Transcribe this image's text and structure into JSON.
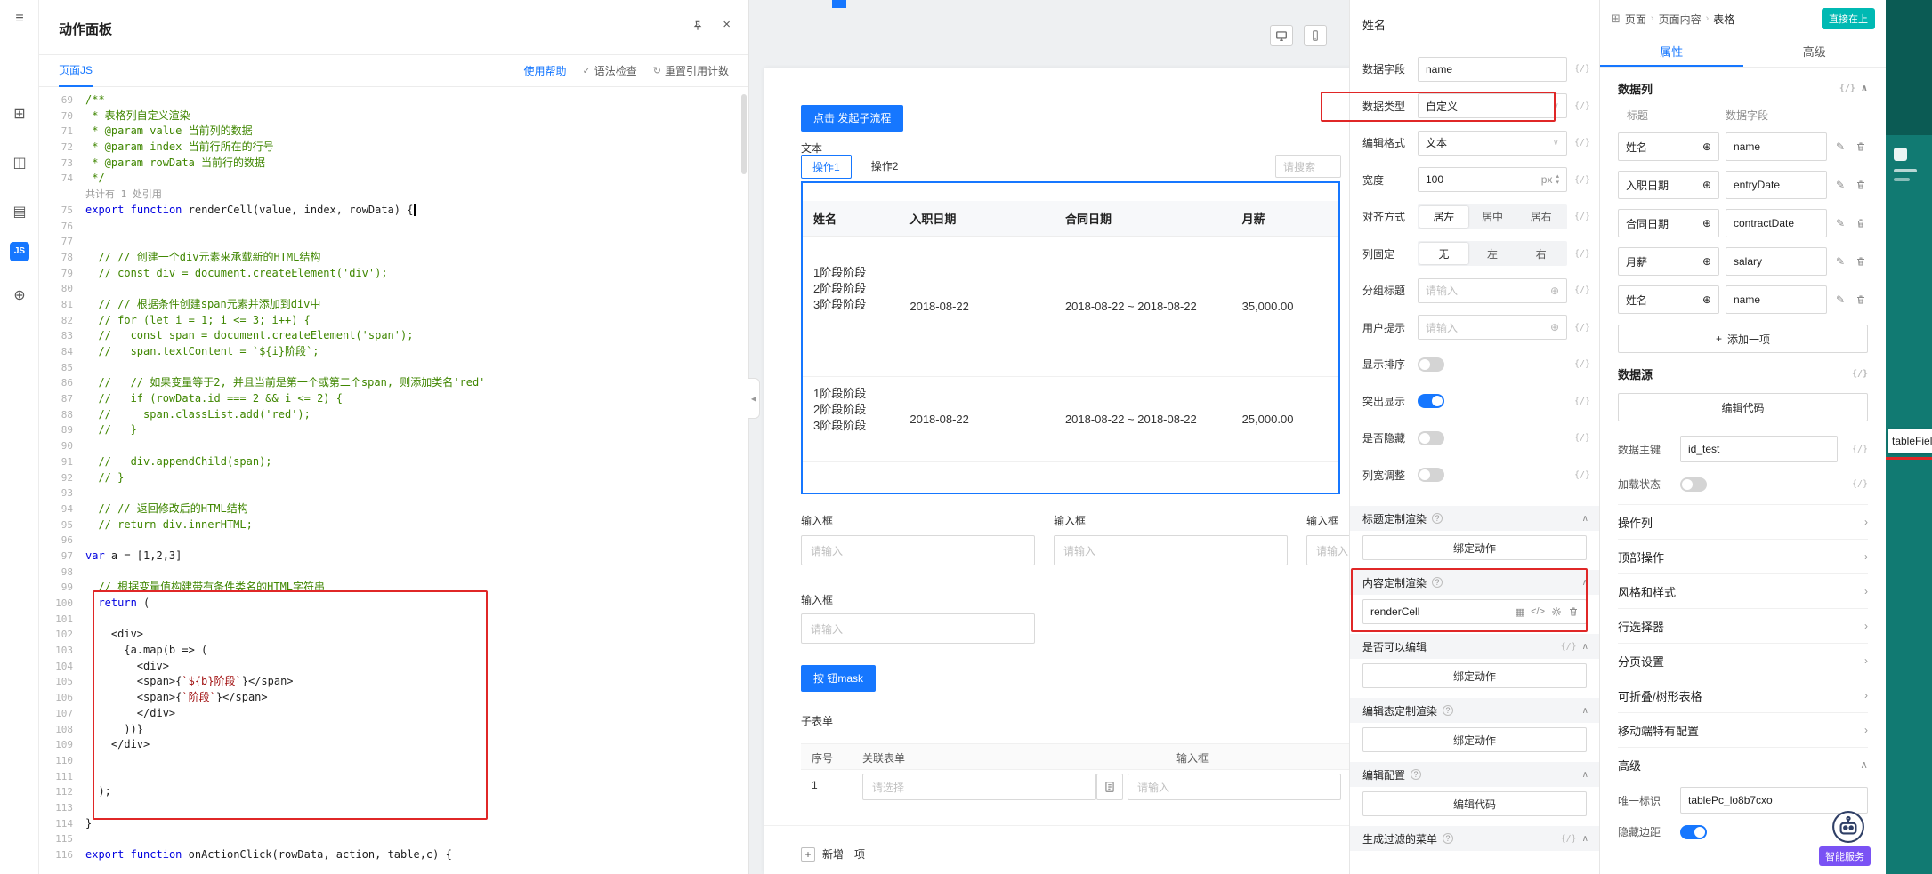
{
  "icons": {
    "menu": "≡",
    "apps": "⊞",
    "components": "◫",
    "database": "▤",
    "js_badge": "JS",
    "globe_nav": "⊕",
    "close": "×",
    "check": "✓",
    "refresh": "↻",
    "collapse_left": "◀",
    "fx": "{/}",
    "info": "?",
    "chevron_up": "∧",
    "chevron_down": "∨",
    "chevron_right": "›",
    "breadcrumb_sep": "›",
    "globe": "⊕",
    "pencil": "✎",
    "plus": "+",
    "code": "</>",
    "grid": "▦",
    "step_up": "▴",
    "step_down": "▾"
  },
  "action_panel": {
    "title": "动作面板",
    "tab": "页面JS",
    "links": [
      "使用帮助",
      "语法检查",
      "重置引用计数"
    ],
    "code_lines": [
      {
        "n": 69,
        "t": "c",
        "s": "/**"
      },
      {
        "n": 70,
        "t": "c",
        "s": " * 表格列自定义渲染"
      },
      {
        "n": 71,
        "t": "c",
        "s": " * @param value 当前列的数据"
      },
      {
        "n": 72,
        "t": "c",
        "s": " * @param index 当前行所在的行号"
      },
      {
        "n": 73,
        "t": "c",
        "s": " * @param rowData 当前行的数据"
      },
      {
        "n": 74,
        "t": "c",
        "s": " */"
      },
      {
        "t": "x",
        "s": "共计有 1 处引用"
      },
      {
        "n": 75,
        "t": "p",
        "s": "export function renderCell(value, index, rowData) {",
        "cursor": true
      },
      {
        "n": 76,
        "t": "p",
        "s": ""
      },
      {
        "n": 77,
        "t": "p",
        "s": ""
      },
      {
        "n": 78,
        "t": "c",
        "s": "  // // 创建一个div元素来承载新的HTML结构"
      },
      {
        "n": 79,
        "t": "c",
        "s": "  // const div = document.createElement('div');"
      },
      {
        "n": 80,
        "t": "p",
        "s": ""
      },
      {
        "n": 81,
        "t": "c",
        "s": "  // // 根据条件创建span元素并添加到div中"
      },
      {
        "n": 82,
        "t": "c",
        "s": "  // for (let i = 1; i <= 3; i++) {"
      },
      {
        "n": 83,
        "t": "c",
        "s": "  //   const span = document.createElement('span');"
      },
      {
        "n": 84,
        "t": "c",
        "s": "  //   span.textContent = `${i}阶段`;"
      },
      {
        "n": 85,
        "t": "p",
        "s": ""
      },
      {
        "n": 86,
        "t": "c",
        "s": "  //   // 如果变量等于2, 并且当前是第一个或第二个span, 则添加类名'red'"
      },
      {
        "n": 87,
        "t": "c",
        "s": "  //   if (rowData.id === 2 && i <= 2) {"
      },
      {
        "n": 88,
        "t": "c",
        "s": "  //     span.classList.add('red');"
      },
      {
        "n": 89,
        "t": "c",
        "s": "  //   }"
      },
      {
        "n": 90,
        "t": "p",
        "s": ""
      },
      {
        "n": 91,
        "t": "c",
        "s": "  //   div.appendChild(span);"
      },
      {
        "n": 92,
        "t": "c",
        "s": "  // }"
      },
      {
        "n": 93,
        "t": "p",
        "s": ""
      },
      {
        "n": 94,
        "t": "c",
        "s": "  // // 返回修改后的HTML结构"
      },
      {
        "n": 95,
        "t": "c",
        "s": "  // return div.innerHTML;"
      },
      {
        "n": 96,
        "t": "p",
        "s": ""
      },
      {
        "n": 97,
        "t": "p",
        "s": "var a = [1,2,3]"
      },
      {
        "n": 98,
        "t": "p",
        "s": ""
      },
      {
        "n": 99,
        "t": "c",
        "s": "  // 根据变量值构建带有条件类名的HTML字符串"
      },
      {
        "n": 100,
        "t": "p",
        "s": "  return ("
      },
      {
        "n": 101,
        "t": "p",
        "s": ""
      },
      {
        "n": 102,
        "t": "p",
        "s": "    <div>"
      },
      {
        "n": 103,
        "t": "p",
        "s": "      {a.map(b => ("
      },
      {
        "n": 104,
        "t": "p",
        "s": "        <div>"
      },
      {
        "n": 105,
        "t": "p",
        "s": "        <span>{`${b}阶段`}</span>"
      },
      {
        "n": 106,
        "t": "p",
        "s": "        <span>{`阶段`}</span>"
      },
      {
        "n": 107,
        "t": "p",
        "s": "        </div>"
      },
      {
        "n": 108,
        "t": "p",
        "s": "      ))}"
      },
      {
        "n": 109,
        "t": "p",
        "s": "    </div>"
      },
      {
        "n": 110,
        "t": "p",
        "s": ""
      },
      {
        "n": 111,
        "t": "p",
        "s": ""
      },
      {
        "n": 112,
        "t": "p",
        "s": "  );"
      },
      {
        "n": 113,
        "t": "p",
        "s": ""
      },
      {
        "n": 114,
        "t": "p",
        "s": "}"
      },
      {
        "n": 115,
        "t": "p",
        "s": ""
      },
      {
        "n": 116,
        "t": "p",
        "s": "export function onActionClick(rowData, action, table,c) {"
      }
    ]
  },
  "canvas": {
    "subflow_button": "点击 发起子流程",
    "text_label": "文本",
    "tabs": [
      "操作1",
      "操作2"
    ],
    "search_placeholder": "请搜索",
    "table": {
      "columns": [
        "姓名",
        "入职日期",
        "合同日期",
        "月薪"
      ],
      "rows": [
        {
          "stages": [
            "1阶段阶段",
            "2阶段阶段",
            "3阶段阶段"
          ],
          "entry": "2018-08-22",
          "contract": "2018-08-22 ~ 2018-08-22",
          "salary": "35,000.00"
        },
        {
          "stages": [
            "1阶段阶段",
            "2阶段阶段",
            "3阶段阶段"
          ],
          "entry": "2018-08-22",
          "contract": "2018-08-22 ~ 2018-08-22",
          "salary": "25,000.00"
        }
      ]
    },
    "input_fields": [
      {
        "label": "输入框",
        "placeholder": "请输入"
      },
      {
        "label": "输入框",
        "placeholder": "请输入"
      },
      {
        "label": "输入框",
        "placeholder": "请输入"
      }
    ],
    "single_input": {
      "label": "输入框",
      "placeholder": "请输入"
    },
    "mask_button": "按 钮mask",
    "subform": {
      "title": "子表单",
      "columns": [
        "序号",
        "关联表单",
        "输入框"
      ],
      "row_index": "1",
      "select_placeholder": "请选择",
      "input_placeholder": "请输入",
      "add_item": "新增一项"
    }
  },
  "inspector": {
    "title": "姓名",
    "fields": [
      {
        "label": "数据字段",
        "value": "name"
      },
      {
        "label": "数据类型",
        "value": "自定义"
      },
      {
        "label": "编辑格式",
        "value": "文本"
      },
      {
        "label": "宽度",
        "value": "100",
        "unit": "px"
      },
      {
        "label": "对齐方式",
        "options": [
          "居左",
          "居中",
          "居右"
        ],
        "active": "居左"
      },
      {
        "label": "列固定",
        "options": [
          "无",
          "左",
          "右"
        ],
        "active": "无"
      },
      {
        "label": "分组标题",
        "placeholder": "请输入"
      },
      {
        "label": "用户提示",
        "placeholder": "请输入"
      },
      {
        "label": "显示排序",
        "on": false
      },
      {
        "label": "突出显示",
        "on": true
      },
      {
        "label": "是否隐藏",
        "on": false
      },
      {
        "label": "列宽调整",
        "on": false
      }
    ],
    "sections": [
      {
        "title": "标题定制渲染",
        "control": "绑定动作"
      },
      {
        "title": "内容定制渲染",
        "value": "renderCell"
      },
      {
        "title": "是否可以编辑",
        "control": "绑定动作"
      },
      {
        "title": "编辑态定制渲染",
        "control": "绑定动作"
      },
      {
        "title": "编辑配置",
        "control": "编辑代码"
      },
      {
        "title": "生成过滤的菜单"
      }
    ]
  },
  "right_panel": {
    "breadcrumb": [
      "页面",
      "页面内容",
      "表格"
    ],
    "badge": "直接在上",
    "tabs": [
      "属性",
      "高级"
    ],
    "data_columns": {
      "title": "数据列",
      "headers": [
        "标题",
        "数据字段"
      ],
      "rows": [
        {
          "title": "姓名",
          "field": "name"
        },
        {
          "title": "入职日期",
          "field": "entryDate"
        },
        {
          "title": "合同日期",
          "field": "contractDate"
        },
        {
          "title": "月薪",
          "field": "salary"
        },
        {
          "title": "姓名",
          "field": "name"
        }
      ],
      "add_item": "添加一项"
    },
    "data_source": {
      "title": "数据源",
      "button": "编辑代码"
    },
    "primary_key": {
      "label": "数据主键",
      "value": "id_test"
    },
    "loading": {
      "label": "加载状态",
      "on": false
    },
    "nav": [
      "操作列",
      "顶部操作",
      "风格和样式",
      "行选择器",
      "分页设置",
      "可折叠/树形表格",
      "移动端特有配置"
    ],
    "advanced": {
      "title": "高级",
      "unique_id": {
        "label": "唯一标识",
        "value": "tablePc_lo8b7cxo"
      },
      "hide_margin": {
        "label": "隐藏边距",
        "on": true
      }
    }
  },
  "overlay": {
    "assistant_label": "智能服务",
    "side_label": "tableFiel"
  }
}
